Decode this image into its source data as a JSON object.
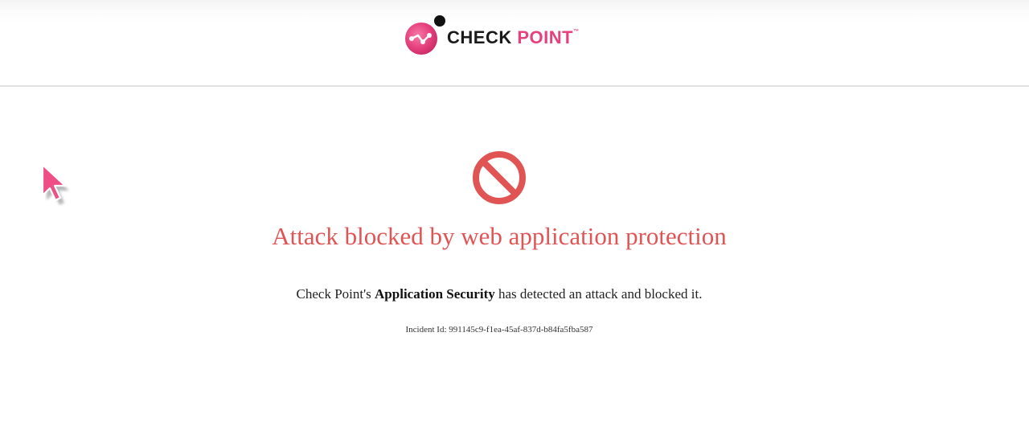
{
  "header": {
    "brand_word1": "CHECK",
    "brand_word2": "POINT",
    "brand_tm": "™",
    "logo_icon": "check-point-logo-icon"
  },
  "main": {
    "icon": "prohibited-icon",
    "title": "Attack blocked by web application protection",
    "message_prefix": "Check Point's ",
    "message_bold": "Application Security",
    "message_suffix": " has detected an attack and blocked it.",
    "incident_label": "Incident Id: ",
    "incident_id": "991145c9-f1ea-45af-837d-b84fa5fba587"
  },
  "cursor": {
    "icon": "mouse-pointer-icon"
  },
  "colors": {
    "brand_pink": "#e5417e",
    "alert_red": "#e05454",
    "text_dark": "#222222"
  }
}
